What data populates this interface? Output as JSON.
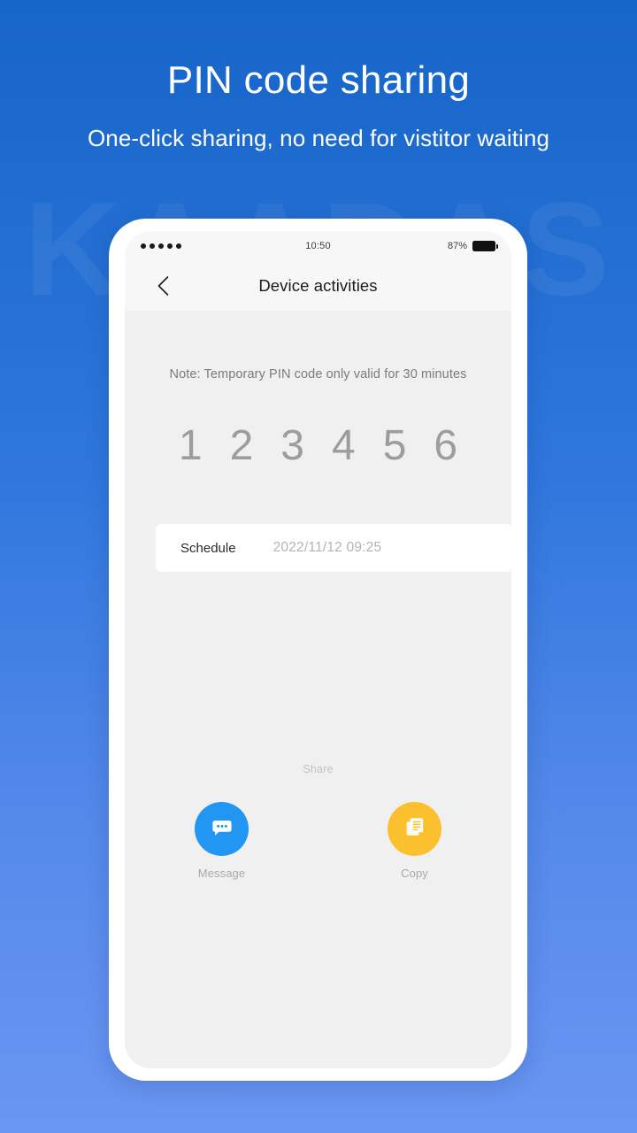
{
  "promo": {
    "title": "PIN code sharing",
    "subtitle": "One-click sharing, no need for vistitor waiting",
    "watermark": "KAADAS",
    "background_top": "#1665c8",
    "background_bottom": "#6a96f2"
  },
  "phone": {
    "status_bar": {
      "signal_dots": 5,
      "time": "10:50",
      "battery_percent": "87%",
      "battery_icon": "battery-full-icon"
    },
    "nav_bar": {
      "back_icon": "chevron-left-icon",
      "title": "Device activities"
    },
    "content": {
      "note": "Note: Temporary PIN code only valid for 30 minutes",
      "pin_digits": [
        "1",
        "2",
        "3",
        "4",
        "5",
        "6"
      ],
      "schedule": {
        "label": "Schedule",
        "value": "2022/11/12 09:25"
      },
      "share": {
        "title": "Share",
        "actions": [
          {
            "label": "Message",
            "icon": "message-bubble-icon",
            "color": "#2196f3"
          },
          {
            "label": "Copy",
            "icon": "copy-documents-icon",
            "color": "#fbc02d"
          }
        ]
      }
    }
  }
}
